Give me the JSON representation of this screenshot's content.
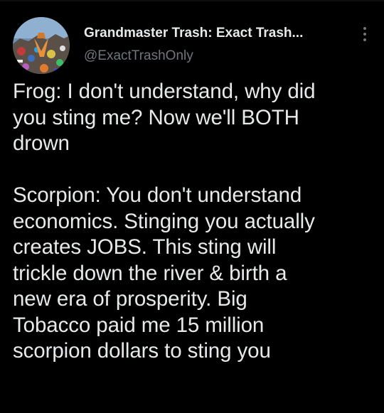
{
  "author": {
    "display_name": "Grandmaster Trash: Exact Trash...",
    "handle": "@ExactTrashOnly",
    "avatar_icon": "trash-pile-avatar"
  },
  "menu": {
    "icon": "more-vertical-icon"
  },
  "tweet": {
    "paragraph1_lines": [
      "Frog: I don't understand, why did",
      "you sting me? Now we'll BOTH",
      "drown"
    ],
    "paragraph2_lines": [
      "Scorpion: You don't understand",
      "economics. Stinging you actually",
      "creates JOBS. This sting will",
      "trickle down the river & birth a",
      "new era of prosperity. Big",
      "Tobacco paid me 15 million",
      "scorpion dollars to sting you"
    ]
  },
  "colors": {
    "background": "#000000",
    "text": "#e7e9ea",
    "secondary": "#71767b"
  }
}
